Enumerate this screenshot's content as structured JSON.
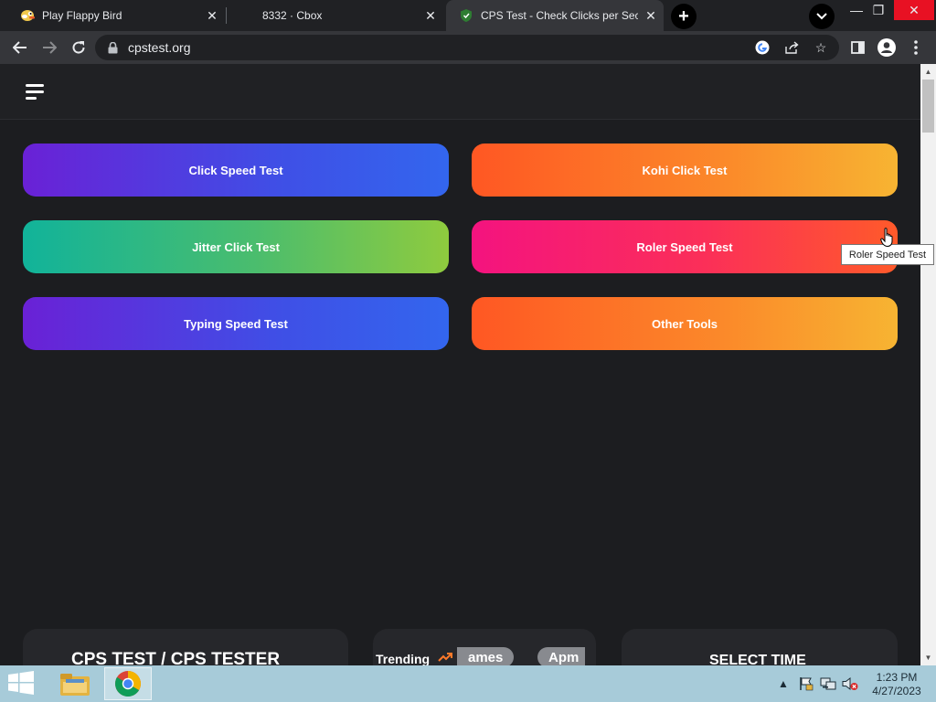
{
  "browser": {
    "tabs": [
      {
        "title": "Play Flappy Bird",
        "icon": "flappy-bird-icon"
      },
      {
        "title": "8332 · Cbox",
        "icon": ""
      },
      {
        "title": "CPS Test - Check Clicks per Second",
        "icon": "shield-icon"
      }
    ],
    "url": "cpstest.org"
  },
  "nav_buttons": [
    {
      "label": "Click Speed Test"
    },
    {
      "label": "Kohi Click Test"
    },
    {
      "label": "Jitter Click Test"
    },
    {
      "label": "Roler Speed Test"
    },
    {
      "label": "Typing Speed Test"
    },
    {
      "label": "Other Tools"
    }
  ],
  "tooltip": "Roler Speed Test",
  "cards": {
    "cps_title": "CPS TEST / CPS TESTER",
    "trending_label": "Trending",
    "trending_pills": [
      "ames",
      "Apm"
    ],
    "select_time": "SELECT TIME"
  },
  "taskbar": {
    "time": "1:23 PM",
    "date": "4/27/2023"
  },
  "colors": {
    "page_bg": "#1c1d20",
    "accent_blue": "#3f4fe6",
    "accent_orange": "#fb8a2a",
    "accent_green": "#4bbd6d",
    "accent_pink": "#fb2f58",
    "taskbar": "#a7cbd9"
  }
}
